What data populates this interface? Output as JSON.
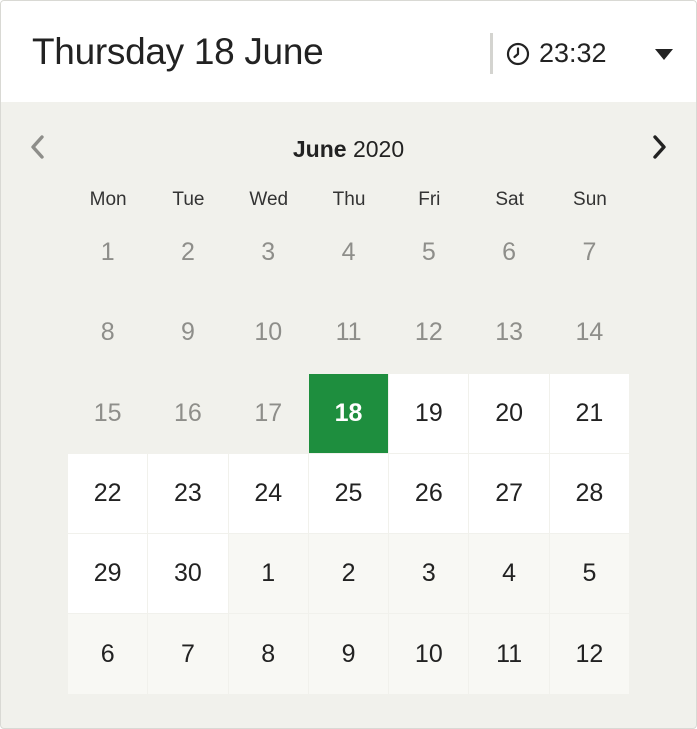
{
  "header": {
    "selected_date": "Thursday 18 June",
    "time": "23:32",
    "time_icon": "clock-icon",
    "dropdown_icon": "chevron-down-icon"
  },
  "calendar": {
    "month": "June",
    "year": "2020",
    "prev_icon": "chevron-left-icon",
    "next_icon": "chevron-right-icon",
    "weekdays": [
      "Mon",
      "Tue",
      "Wed",
      "Thu",
      "Fri",
      "Sat",
      "Sun"
    ],
    "days": [
      {
        "label": "1",
        "state": "past"
      },
      {
        "label": "2",
        "state": "past"
      },
      {
        "label": "3",
        "state": "past"
      },
      {
        "label": "4",
        "state": "past"
      },
      {
        "label": "5",
        "state": "past"
      },
      {
        "label": "6",
        "state": "past"
      },
      {
        "label": "7",
        "state": "past"
      },
      {
        "label": "8",
        "state": "past"
      },
      {
        "label": "9",
        "state": "past"
      },
      {
        "label": "10",
        "state": "past"
      },
      {
        "label": "11",
        "state": "past"
      },
      {
        "label": "12",
        "state": "past"
      },
      {
        "label": "13",
        "state": "past"
      },
      {
        "label": "14",
        "state": "past"
      },
      {
        "label": "15",
        "state": "past"
      },
      {
        "label": "16",
        "state": "past"
      },
      {
        "label": "17",
        "state": "past"
      },
      {
        "label": "18",
        "state": "selected"
      },
      {
        "label": "19",
        "state": "avail"
      },
      {
        "label": "20",
        "state": "avail"
      },
      {
        "label": "21",
        "state": "avail"
      },
      {
        "label": "22",
        "state": "avail"
      },
      {
        "label": "23",
        "state": "avail"
      },
      {
        "label": "24",
        "state": "avail"
      },
      {
        "label": "25",
        "state": "avail"
      },
      {
        "label": "26",
        "state": "avail"
      },
      {
        "label": "27",
        "state": "avail"
      },
      {
        "label": "28",
        "state": "avail"
      },
      {
        "label": "29",
        "state": "avail"
      },
      {
        "label": "30",
        "state": "avail"
      },
      {
        "label": "1",
        "state": "next"
      },
      {
        "label": "2",
        "state": "next"
      },
      {
        "label": "3",
        "state": "next"
      },
      {
        "label": "4",
        "state": "next"
      },
      {
        "label": "5",
        "state": "next"
      },
      {
        "label": "6",
        "state": "next"
      },
      {
        "label": "7",
        "state": "next"
      },
      {
        "label": "8",
        "state": "next"
      },
      {
        "label": "9",
        "state": "next"
      },
      {
        "label": "10",
        "state": "next"
      },
      {
        "label": "11",
        "state": "next"
      },
      {
        "label": "12",
        "state": "next"
      }
    ]
  },
  "colors": {
    "selected_bg": "#1e8e3e",
    "panel_bg": "#f1f1ec",
    "available_bg": "#ffffff",
    "past_text": "#8e8e8a"
  }
}
